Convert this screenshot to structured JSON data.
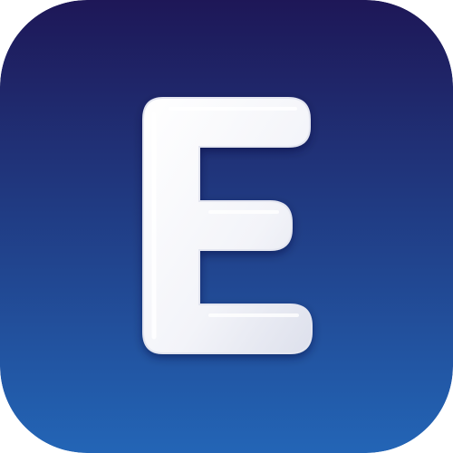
{
  "icon": {
    "semantic_name": "letter-e-app-icon",
    "glyph": "E",
    "colors": {
      "background_top": "#1e1757",
      "background_bottom": "#2365b6",
      "glyph_fill": "#f5f6fa",
      "glyph_shadow": "#dfe2ee"
    }
  }
}
